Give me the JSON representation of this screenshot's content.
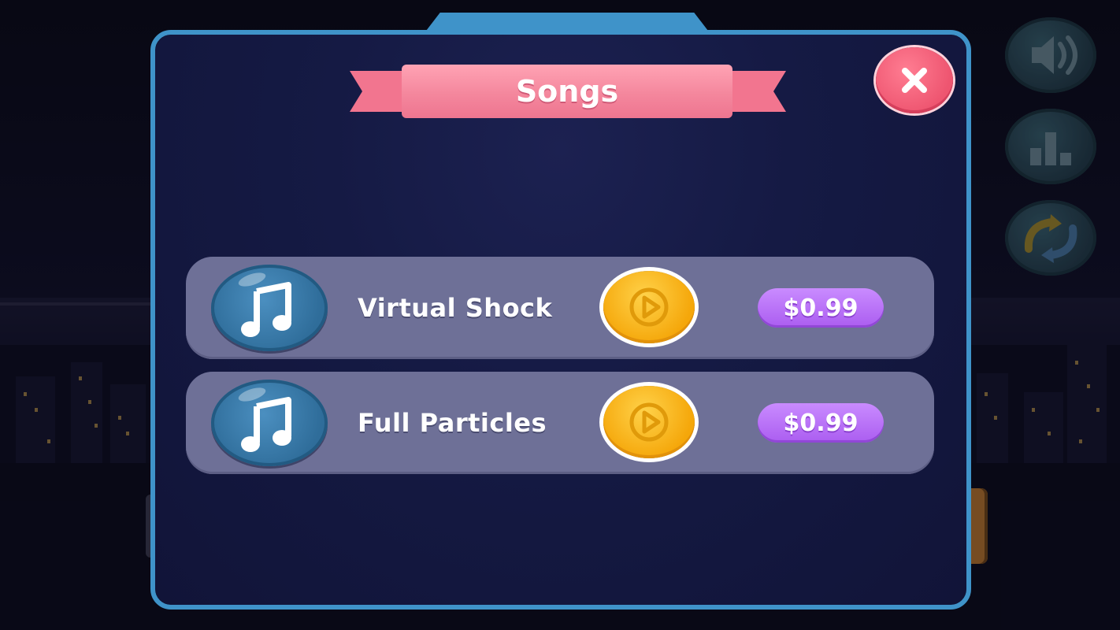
{
  "dialog": {
    "title": "Songs"
  },
  "songs": [
    {
      "title": "Virtual Shock",
      "price": "$0.99"
    },
    {
      "title": "Full Particles",
      "price": "$0.99"
    }
  ],
  "side_buttons": [
    {
      "icon": "speaker-icon"
    },
    {
      "icon": "leaderboard-icon"
    },
    {
      "icon": "refresh-icon"
    }
  ],
  "colors": {
    "panel_border": "#3f93c9",
    "panel_bg": "#15173e",
    "ribbon": "#f4879d",
    "play_button": "#f5a70a",
    "price_button": "#ab5df0",
    "note_button": "#2f6d9a"
  }
}
